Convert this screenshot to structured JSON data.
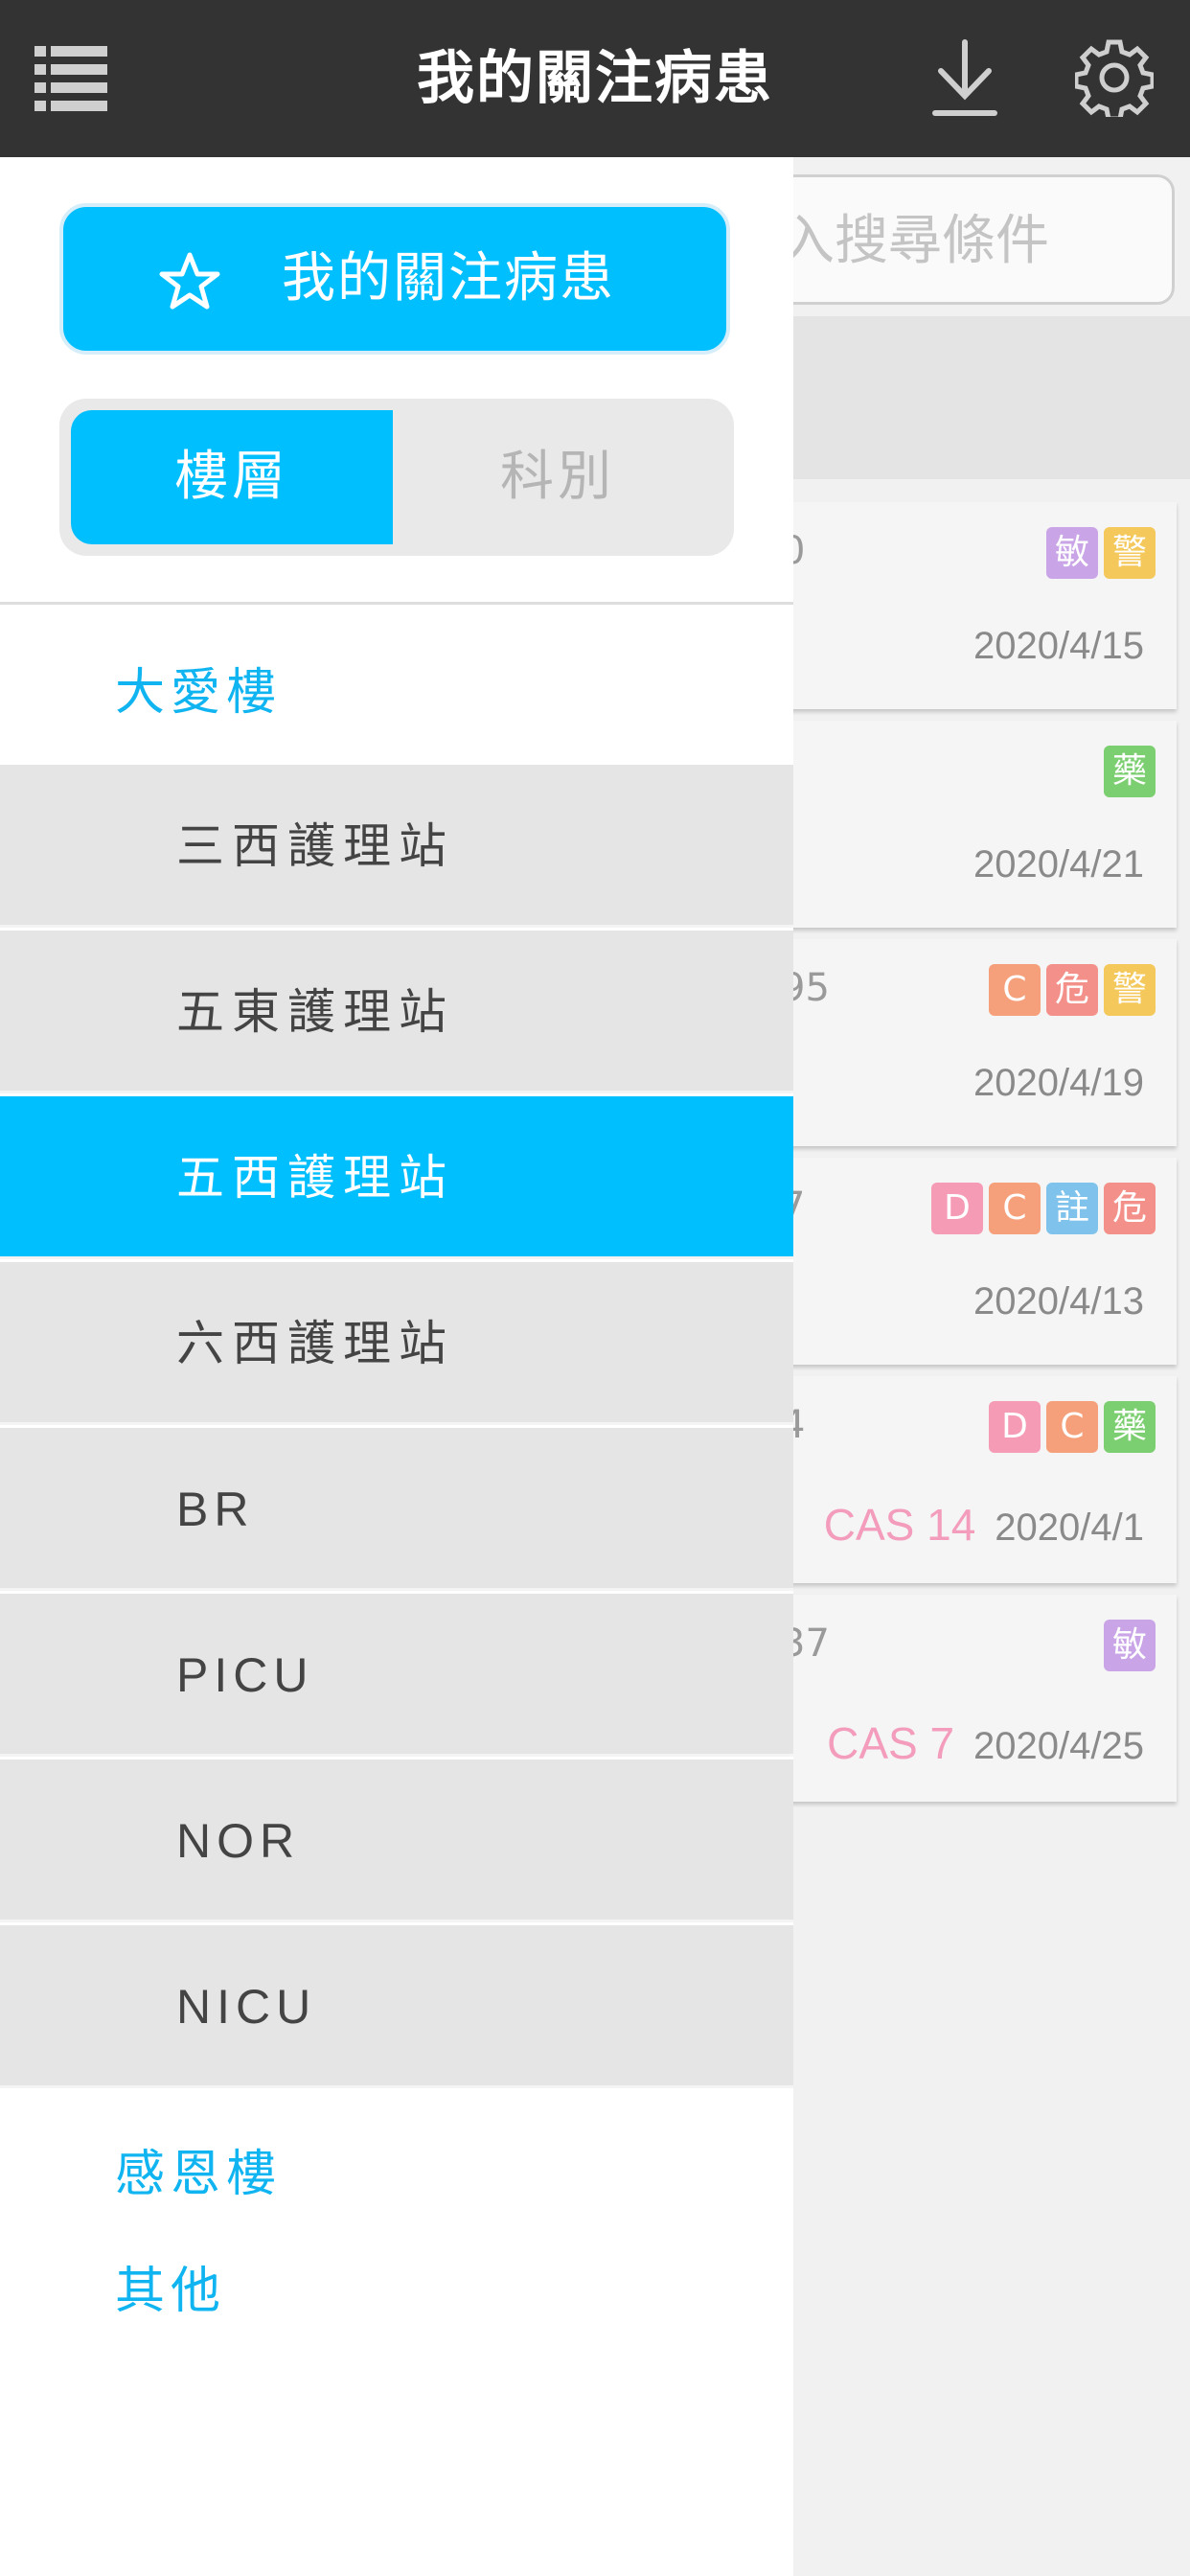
{
  "header": {
    "title": "我的關注病患",
    "menu_icon": "list-menu-icon",
    "download_icon": "download-icon",
    "settings_icon": "gear-icon"
  },
  "search": {
    "placeholder": "輸入搜尋條件",
    "visible_text": "入搜尋條件"
  },
  "cards": [
    {
      "fragment": "0",
      "tags": [
        {
          "text": "敏",
          "color": "#c9a4e6"
        },
        {
          "text": "警",
          "color": "#f4c85a"
        }
      ],
      "cas": "",
      "date": "2020/4/15"
    },
    {
      "fragment": "",
      "tags": [
        {
          "text": "藥",
          "color": "#7ccf70"
        }
      ],
      "cas": "",
      "date": "2020/4/21"
    },
    {
      "fragment": "95",
      "tags": [
        {
          "text": "C",
          "color": "#f5a07a"
        },
        {
          "text": "危",
          "color": "#f4908a"
        },
        {
          "text": "警",
          "color": "#f4c85a"
        }
      ],
      "cas": "",
      "date": "2020/4/19"
    },
    {
      "fragment": "7",
      "tags": [
        {
          "text": "D",
          "color": "#f59bb6"
        },
        {
          "text": "C",
          "color": "#f5a07a"
        },
        {
          "text": "註",
          "color": "#7fc3ec"
        },
        {
          "text": "危",
          "color": "#f4908a"
        }
      ],
      "cas": "",
      "date": "2020/4/13"
    },
    {
      "fragment": "4",
      "tags": [
        {
          "text": "D",
          "color": "#f59bb6"
        },
        {
          "text": "C",
          "color": "#f5a07a"
        },
        {
          "text": "藥",
          "color": "#7ccf70"
        }
      ],
      "cas": "CAS 14",
      "date": "2020/4/1"
    },
    {
      "fragment": "37",
      "tags": [
        {
          "text": "敏",
          "color": "#c9a4e6"
        }
      ],
      "cas": "CAS 7",
      "date": "2020/4/25"
    }
  ],
  "drawer": {
    "favorite_button": {
      "label": "我的關注病患",
      "icon": "star-icon"
    },
    "segments": [
      {
        "label": "樓層",
        "selected": true
      },
      {
        "label": "科別",
        "selected": false
      }
    ],
    "buildings": [
      {
        "name": "大愛樓",
        "items": [
          {
            "label": "三西護理站",
            "active": false
          },
          {
            "label": "五東護理站",
            "active": false
          },
          {
            "label": "五西護理站",
            "active": true
          },
          {
            "label": "六西護理站",
            "active": false
          },
          {
            "label": "BR",
            "active": false
          },
          {
            "label": "PICU",
            "active": false
          },
          {
            "label": "NOR",
            "active": false
          },
          {
            "label": "NICU",
            "active": false
          }
        ]
      },
      {
        "name": "感恩樓",
        "items": []
      },
      {
        "name": "其他",
        "items": []
      }
    ]
  },
  "colors": {
    "accent": "#00bfff",
    "header_bg": "#333333",
    "section_text": "#0fb4f0",
    "cas_text": "#f39cbc"
  }
}
